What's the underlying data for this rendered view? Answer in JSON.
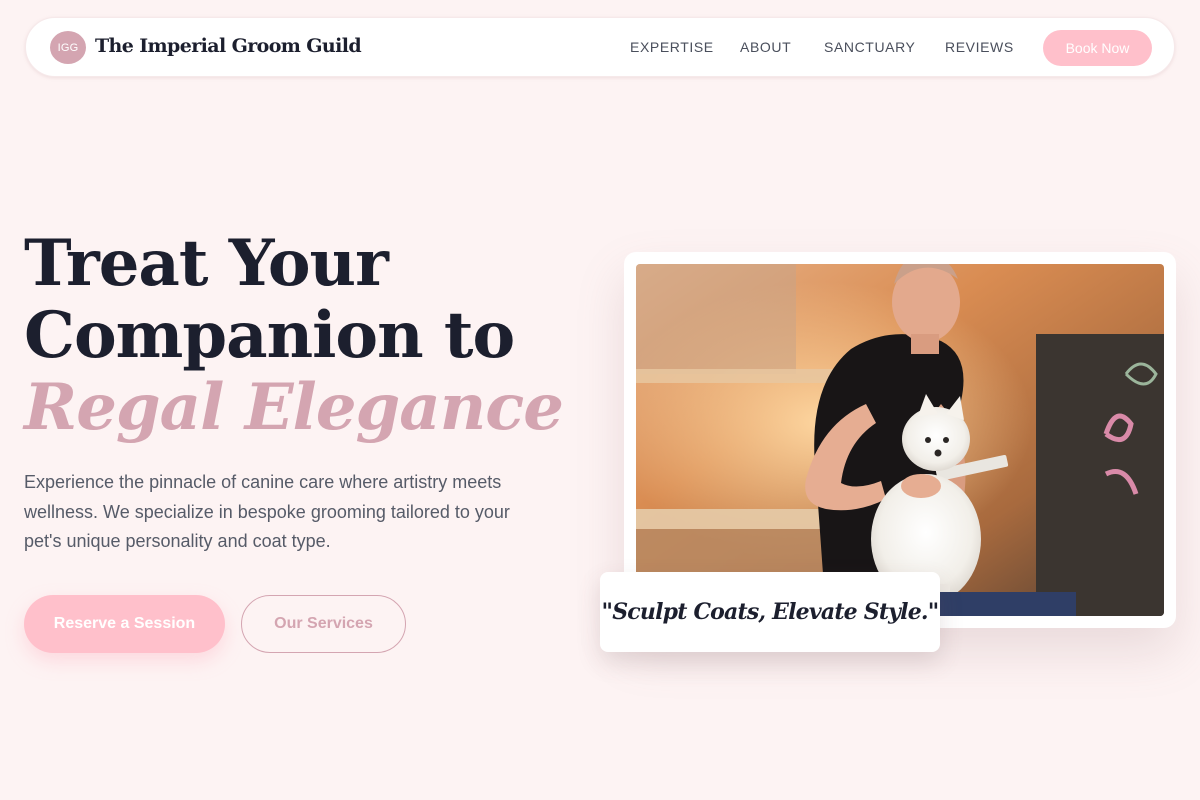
{
  "nav": {
    "logo_initials": "IGG",
    "brand_name": "The Imperial Groom Guild",
    "links": [
      "EXPERTISE",
      "ABOUT",
      "SANCTUARY",
      "REVIEWS"
    ],
    "cta_label": "Book Now"
  },
  "hero": {
    "headline_line1": "Treat Your",
    "headline_line2": "Companion to",
    "headline_accent": "Regal Elegance",
    "description": "Experience the pinnacle of canine care where artistry meets wellness. We specialize in bespoke grooming tailored to your pet's unique personality and coat type.",
    "primary_cta": "Reserve a Session",
    "secondary_cta": "Our Services"
  },
  "photo": {
    "subject": "groomer-brushing-white-pomeranian",
    "quote": "\"Sculpt Coats, Elevate Style.\""
  },
  "colors": {
    "background": "#fdf3f3",
    "accent_pink": "#ffc0cb",
    "accent_mauve": "#d4a5b1",
    "text_dark": "#1c1f2e",
    "text_body": "#565b68"
  }
}
